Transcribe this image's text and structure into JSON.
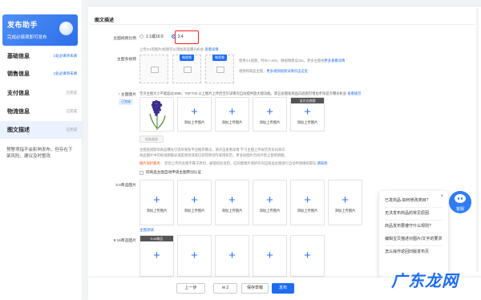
{
  "sidebar": {
    "promo_title": "发布助手",
    "promo_sub": "完成必填项即可发布",
    "items": [
      {
        "label": "基础信息",
        "status": "1处必填项未填"
      },
      {
        "label": "销售信息",
        "status": "1处必填项未填"
      },
      {
        "label": "支付信息",
        "status": "已完成"
      },
      {
        "label": "物流信息",
        "status": "已完成"
      },
      {
        "label": "图文描述",
        "status": "已完成"
      }
    ],
    "tip": "预警项指不会影响发布、但存在下架风险、建议及时整改"
  },
  "main": {
    "section_title": "图文描述",
    "ratio_label": "主图视频比例",
    "ratio_options": [
      "1:1或16:9",
      "3:4"
    ],
    "ratio_selected": "3:4",
    "ratio_hint": "上传3:4的图片/视频可以增加商品曝光机会",
    "ratio_hint_link": "查看详情",
    "video_label": "主图多视频",
    "video_tags": [
      "微视频",
      "微视频"
    ],
    "video_hint1": "使用3:4视频，时长<=60s，微视频建议15s，更多主图视",
    "video_hint2": "视频和商品主图，",
    "video_hint_link1": "更多查看详情",
    "video_hint_link2": "更多视频规则详情点击这里",
    "main_image_label": "主图图片",
    "main_image_hint": "宝贝主图大小不能超过3MB；700*700 以上图片上传后宝贝详情页自动提供放大镜功能。第五张图发商品白底图可增加手淘首页曝光机会",
    "main_image_hint_link": "查看规范",
    "completed_badge": "已完成",
    "white_bg_caption": "宝贝白底图",
    "add_image": "添加上传图片",
    "smart_button": "智能裁图",
    "info_para1": "主图直接影响商品曝光引流效果及平台推荐算法，请点击查看详情 学习主图上传规范及优化知识",
    "info_para2": "商品图片中的每张图都必须是原创或者已获得原创作者授权后，更多动图片合同外禁止使用原图。",
    "protect_label": "图片保护服务",
    "protect_text": "若您上传的主图不属于原创，被侵权投诉后，应同意图片保护的对应商品主图进行自动申请维权取证",
    "protect_link": "请知悉",
    "auto_check": "同商品主图自动申请主图原创认证",
    "r34_label": "3:4商品图片",
    "main_test_link": "主图测试",
    "r916_label": "9:16商品图片",
    "r916_caption": "9:16商品"
  },
  "footer": {
    "prev": "上一步",
    "msg_count": "2",
    "save_draft": "保存草稿",
    "publish": "发布"
  },
  "faq": {
    "items": [
      "已发商品-如何修改类目?",
      "无法发布商品的常见原因",
      "商品发布要遵守什么规则?",
      "编辑宝贝描述对图片/文字的要求",
      "怎么操作返回旧版发布页"
    ]
  },
  "assistant_label": "客服",
  "watermark": "广东龙网",
  "colors": {
    "accent": "#1d6cf0",
    "highlight_box": "#e22222",
    "warning": "#f25a1a"
  }
}
